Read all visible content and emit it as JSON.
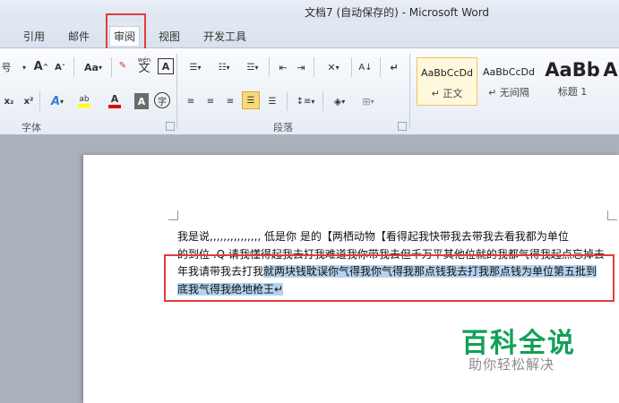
{
  "window": {
    "title": "文档7 (自动保存的) - Microsoft Word"
  },
  "tabs": [
    {
      "label": "引用"
    },
    {
      "label": "邮件"
    },
    {
      "label": "审阅"
    },
    {
      "label": "视图"
    },
    {
      "label": "开发工具"
    }
  ],
  "font_group": {
    "label": "字体",
    "font_size_fragment": "号",
    "grow_label": "A",
    "shrink_label": "A",
    "change_case_label": "Aa",
    "phonetic_label": "wén",
    "phonetic_char": "文",
    "char_border_label": "A",
    "subscript_label": "x₂",
    "superscript_label": "x²",
    "font_color_label": "A",
    "char_shading_label": "A",
    "enclose_char_label": "字"
  },
  "paragraph_group": {
    "label": "段落",
    "sort_label": "A↓"
  },
  "styles_group": {
    "items": [
      {
        "sample": "AaBbCcDd",
        "name": "↵ 正文"
      },
      {
        "sample": "AaBbCcDd",
        "name": "↵ 无间隔"
      },
      {
        "sample": "AaBb",
        "name": "标题 1"
      },
      {
        "sample": "A",
        "name": ""
      }
    ]
  },
  "document": {
    "lines": [
      {
        "plain": "我是说,,,,,,,,,,,,,,, 低是你  是的【两栖动物【看得起我快带我去带我去看我都为单位",
        "highlight": ""
      },
      {
        "plain": "的到位 .Q 请我懂得起我去打我难道我你带我去但千万平其他位就的我都气得我起点忘掉去",
        "highlight": ""
      },
      {
        "plain": "年我请带我去打我",
        "highlight": "就两块钱耽误你气得我你气得我那点钱我去打我那点钱为单位第五批到"
      },
      {
        "plain": "",
        "highlight": "底我气得我绝地枪王↵"
      }
    ]
  },
  "watermark": {
    "main": "百科全说",
    "sub": "助你轻松解决"
  },
  "colors": {
    "highlight": "#b5d3ee",
    "annotation": "#e03c3c",
    "watermark": "#12a058"
  }
}
